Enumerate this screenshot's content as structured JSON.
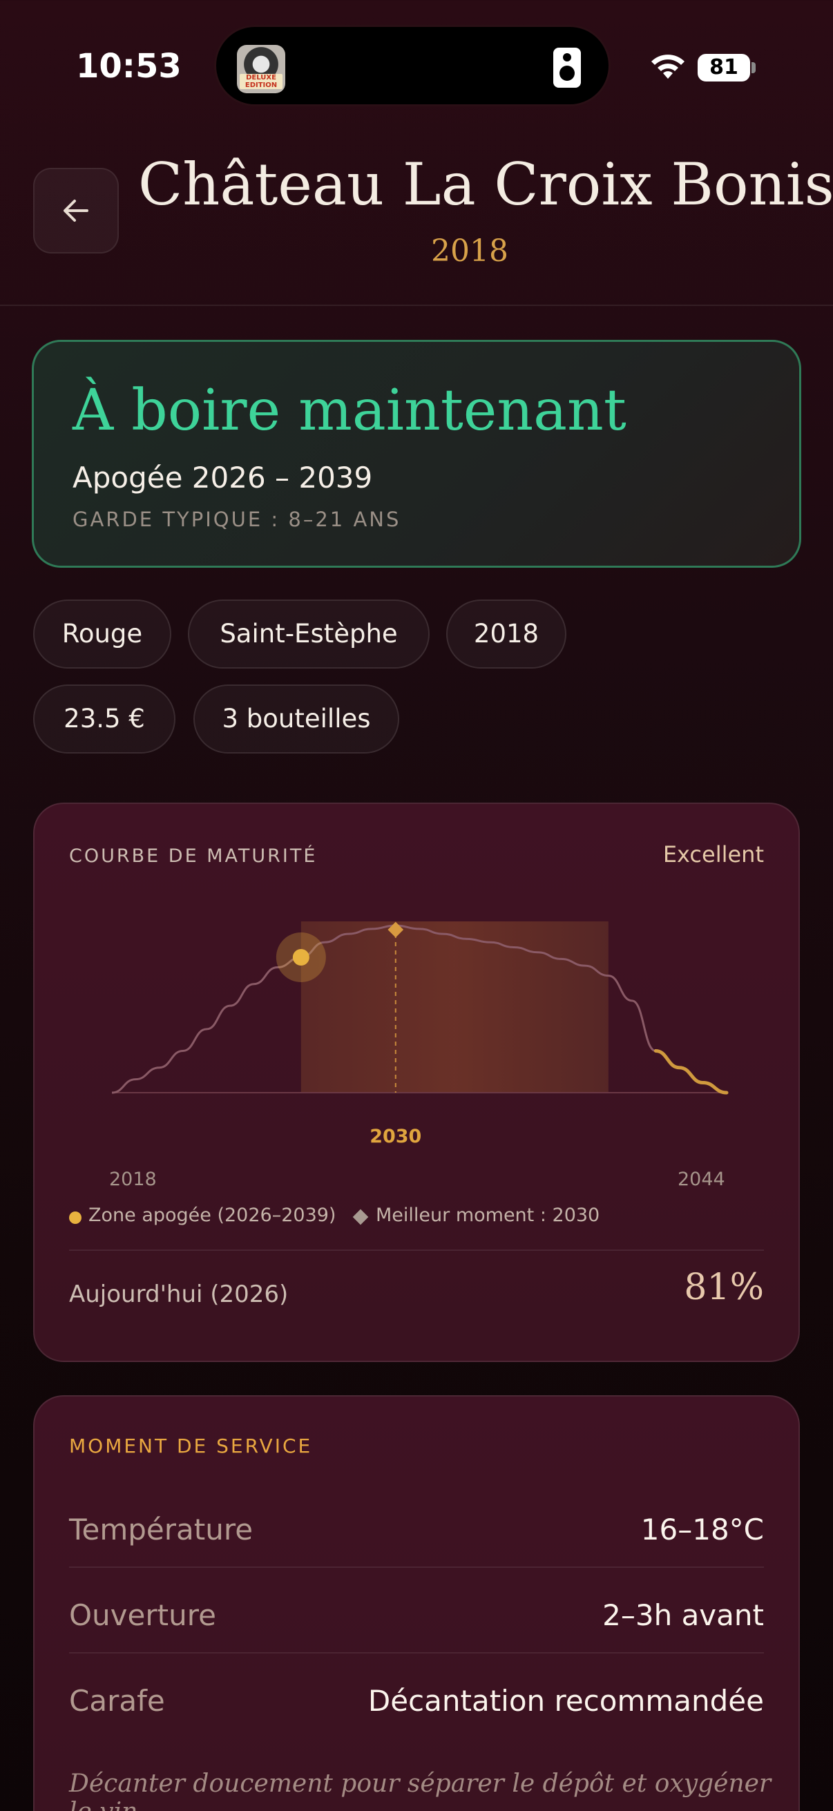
{
  "status_bar": {
    "time": "10:53",
    "battery": "81",
    "album_badge": "DELUXE EDITION",
    "icons": [
      "speaker-icon",
      "wifi-icon",
      "battery-icon"
    ]
  },
  "header": {
    "back_icon": "arrow-left-icon",
    "title": "Château La Croix Bonis",
    "vintage": "2018"
  },
  "drink_status": {
    "title": "À boire maintenant",
    "apogee": "Apogée 2026 – 2039",
    "garde": "GARDE TYPIQUE : 8–21 ANS",
    "accent": "#3ed399"
  },
  "chips": {
    "row1": [
      "Rouge",
      "Saint-Estèphe",
      "2018"
    ],
    "row2": [
      "23.5 €",
      "3 bouteilles"
    ]
  },
  "maturity": {
    "label": "COURBE DE MATURITÉ",
    "rating": "Excellent",
    "best_year_label": "2030",
    "x_start": "2018",
    "x_end": "2044",
    "legend_apogee": "Zone apogée (2026–2039)",
    "legend_best": "Meilleur moment : 2030",
    "today_label": "Aujourd'hui (2026)",
    "today_value": "81%"
  },
  "chart_data": {
    "type": "line",
    "x": [
      2018,
      2019,
      2020,
      2021,
      2022,
      2023,
      2024,
      2025,
      2026,
      2027,
      2028,
      2029,
      2030,
      2031,
      2032,
      2033,
      2034,
      2035,
      2036,
      2037,
      2038,
      2039,
      2040,
      2041,
      2042,
      2043,
      2044
    ],
    "series": [
      {
        "values": [
          0,
          8,
          15,
          25,
          38,
          52,
          65,
          75,
          81,
          90,
          95,
          98,
          100,
          98,
          95,
          92,
          90,
          87,
          84,
          80,
          76,
          70,
          55,
          25,
          15,
          6,
          0
        ]
      }
    ],
    "xlim": [
      2018,
      2044
    ],
    "ylim": [
      0,
      100
    ],
    "apogee_range": [
      2026,
      2039
    ],
    "best_year": 2030,
    "today": 2026,
    "grid": false,
    "colors": {
      "line": "#8a5a66",
      "marker": "#e8b23f",
      "zone": "#6b2f2a",
      "decline": "#d09a3e"
    }
  },
  "service": {
    "label": "MOMENT DE SERVICE",
    "rows": [
      {
        "label": "Température",
        "value": "16–18°C"
      },
      {
        "label": "Ouverture",
        "value": "2–3h avant"
      },
      {
        "label": "Carafe",
        "value": "Décantation recommandée"
      }
    ],
    "note": "Décanter doucement pour séparer le dépôt et oxygéner le vin."
  }
}
